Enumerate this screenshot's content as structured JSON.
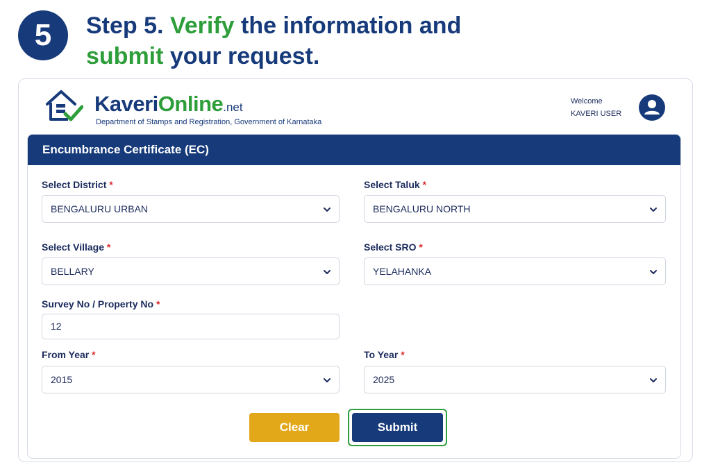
{
  "step": {
    "number": "5",
    "title_part1": "Step 5. ",
    "title_green1": "Verify",
    "title_part2": " the information and",
    "title_green2": "submit",
    "title_part3": " your request."
  },
  "header": {
    "logo_kaveri": "Kaveri",
    "logo_online": "Online",
    "logo_net": ".net",
    "department": "Department of Stamps and Registration, Government of Karnataka",
    "welcome": "Welcome",
    "user": "KAVERI USER",
    "avatar_icon": "user-avatar-icon"
  },
  "panel": {
    "title": "Encumbrance Certificate (EC)"
  },
  "form": {
    "district": {
      "label": "Select District",
      "required": "*",
      "value": "BENGALURU URBAN"
    },
    "taluk": {
      "label": "Select Taluk",
      "required": "*",
      "value": "BENGALURU NORTH"
    },
    "village": {
      "label": "Select Village",
      "required": "*",
      "value": "BELLARY"
    },
    "sro": {
      "label": "Select SRO",
      "required": "*",
      "value": "YELAHANKA"
    },
    "survey": {
      "label": "Survey No / Property No",
      "required": "*",
      "value": "12"
    },
    "from_year": {
      "label": "From Year",
      "required": "*",
      "value": "2015"
    },
    "to_year": {
      "label": "To Year",
      "required": "*",
      "value": "2025"
    }
  },
  "buttons": {
    "clear": "Clear",
    "submit": "Submit"
  },
  "colors": {
    "brand_blue": "#163a7a",
    "brand_green": "#2e9e3b",
    "clear_yellow": "#e3a81a",
    "required_red": "#d92b2b"
  }
}
